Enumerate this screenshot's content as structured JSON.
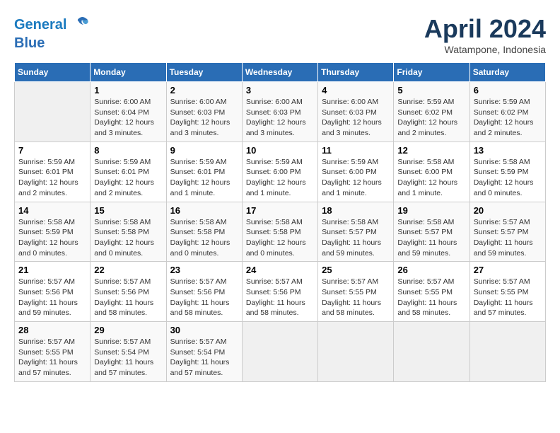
{
  "header": {
    "logo_line1": "General",
    "logo_line2": "Blue",
    "title": "April 2024",
    "subtitle": "Watampone, Indonesia"
  },
  "days_of_week": [
    "Sunday",
    "Monday",
    "Tuesday",
    "Wednesday",
    "Thursday",
    "Friday",
    "Saturday"
  ],
  "weeks": [
    [
      {
        "day": "",
        "sunrise": "",
        "sunset": "",
        "daylight": "",
        "empty": true
      },
      {
        "day": "1",
        "sunrise": "Sunrise: 6:00 AM",
        "sunset": "Sunset: 6:04 PM",
        "daylight": "Daylight: 12 hours and 3 minutes."
      },
      {
        "day": "2",
        "sunrise": "Sunrise: 6:00 AM",
        "sunset": "Sunset: 6:03 PM",
        "daylight": "Daylight: 12 hours and 3 minutes."
      },
      {
        "day": "3",
        "sunrise": "Sunrise: 6:00 AM",
        "sunset": "Sunset: 6:03 PM",
        "daylight": "Daylight: 12 hours and 3 minutes."
      },
      {
        "day": "4",
        "sunrise": "Sunrise: 6:00 AM",
        "sunset": "Sunset: 6:03 PM",
        "daylight": "Daylight: 12 hours and 3 minutes."
      },
      {
        "day": "5",
        "sunrise": "Sunrise: 5:59 AM",
        "sunset": "Sunset: 6:02 PM",
        "daylight": "Daylight: 12 hours and 2 minutes."
      },
      {
        "day": "6",
        "sunrise": "Sunrise: 5:59 AM",
        "sunset": "Sunset: 6:02 PM",
        "daylight": "Daylight: 12 hours and 2 minutes."
      }
    ],
    [
      {
        "day": "7",
        "sunrise": "Sunrise: 5:59 AM",
        "sunset": "Sunset: 6:01 PM",
        "daylight": "Daylight: 12 hours and 2 minutes."
      },
      {
        "day": "8",
        "sunrise": "Sunrise: 5:59 AM",
        "sunset": "Sunset: 6:01 PM",
        "daylight": "Daylight: 12 hours and 2 minutes."
      },
      {
        "day": "9",
        "sunrise": "Sunrise: 5:59 AM",
        "sunset": "Sunset: 6:01 PM",
        "daylight": "Daylight: 12 hours and 1 minute."
      },
      {
        "day": "10",
        "sunrise": "Sunrise: 5:59 AM",
        "sunset": "Sunset: 6:00 PM",
        "daylight": "Daylight: 12 hours and 1 minute."
      },
      {
        "day": "11",
        "sunrise": "Sunrise: 5:59 AM",
        "sunset": "Sunset: 6:00 PM",
        "daylight": "Daylight: 12 hours and 1 minute."
      },
      {
        "day": "12",
        "sunrise": "Sunrise: 5:58 AM",
        "sunset": "Sunset: 6:00 PM",
        "daylight": "Daylight: 12 hours and 1 minute."
      },
      {
        "day": "13",
        "sunrise": "Sunrise: 5:58 AM",
        "sunset": "Sunset: 5:59 PM",
        "daylight": "Daylight: 12 hours and 0 minutes."
      }
    ],
    [
      {
        "day": "14",
        "sunrise": "Sunrise: 5:58 AM",
        "sunset": "Sunset: 5:59 PM",
        "daylight": "Daylight: 12 hours and 0 minutes."
      },
      {
        "day": "15",
        "sunrise": "Sunrise: 5:58 AM",
        "sunset": "Sunset: 5:58 PM",
        "daylight": "Daylight: 12 hours and 0 minutes."
      },
      {
        "day": "16",
        "sunrise": "Sunrise: 5:58 AM",
        "sunset": "Sunset: 5:58 PM",
        "daylight": "Daylight: 12 hours and 0 minutes."
      },
      {
        "day": "17",
        "sunrise": "Sunrise: 5:58 AM",
        "sunset": "Sunset: 5:58 PM",
        "daylight": "Daylight: 12 hours and 0 minutes."
      },
      {
        "day": "18",
        "sunrise": "Sunrise: 5:58 AM",
        "sunset": "Sunset: 5:57 PM",
        "daylight": "Daylight: 11 hours and 59 minutes."
      },
      {
        "day": "19",
        "sunrise": "Sunrise: 5:58 AM",
        "sunset": "Sunset: 5:57 PM",
        "daylight": "Daylight: 11 hours and 59 minutes."
      },
      {
        "day": "20",
        "sunrise": "Sunrise: 5:57 AM",
        "sunset": "Sunset: 5:57 PM",
        "daylight": "Daylight: 11 hours and 59 minutes."
      }
    ],
    [
      {
        "day": "21",
        "sunrise": "Sunrise: 5:57 AM",
        "sunset": "Sunset: 5:56 PM",
        "daylight": "Daylight: 11 hours and 59 minutes."
      },
      {
        "day": "22",
        "sunrise": "Sunrise: 5:57 AM",
        "sunset": "Sunset: 5:56 PM",
        "daylight": "Daylight: 11 hours and 58 minutes."
      },
      {
        "day": "23",
        "sunrise": "Sunrise: 5:57 AM",
        "sunset": "Sunset: 5:56 PM",
        "daylight": "Daylight: 11 hours and 58 minutes."
      },
      {
        "day": "24",
        "sunrise": "Sunrise: 5:57 AM",
        "sunset": "Sunset: 5:56 PM",
        "daylight": "Daylight: 11 hours and 58 minutes."
      },
      {
        "day": "25",
        "sunrise": "Sunrise: 5:57 AM",
        "sunset": "Sunset: 5:55 PM",
        "daylight": "Daylight: 11 hours and 58 minutes."
      },
      {
        "day": "26",
        "sunrise": "Sunrise: 5:57 AM",
        "sunset": "Sunset: 5:55 PM",
        "daylight": "Daylight: 11 hours and 58 minutes."
      },
      {
        "day": "27",
        "sunrise": "Sunrise: 5:57 AM",
        "sunset": "Sunset: 5:55 PM",
        "daylight": "Daylight: 11 hours and 57 minutes."
      }
    ],
    [
      {
        "day": "28",
        "sunrise": "Sunrise: 5:57 AM",
        "sunset": "Sunset: 5:55 PM",
        "daylight": "Daylight: 11 hours and 57 minutes."
      },
      {
        "day": "29",
        "sunrise": "Sunrise: 5:57 AM",
        "sunset": "Sunset: 5:54 PM",
        "daylight": "Daylight: 11 hours and 57 minutes."
      },
      {
        "day": "30",
        "sunrise": "Sunrise: 5:57 AM",
        "sunset": "Sunset: 5:54 PM",
        "daylight": "Daylight: 11 hours and 57 minutes."
      },
      {
        "day": "",
        "sunrise": "",
        "sunset": "",
        "daylight": "",
        "empty": true
      },
      {
        "day": "",
        "sunrise": "",
        "sunset": "",
        "daylight": "",
        "empty": true
      },
      {
        "day": "",
        "sunrise": "",
        "sunset": "",
        "daylight": "",
        "empty": true
      },
      {
        "day": "",
        "sunrise": "",
        "sunset": "",
        "daylight": "",
        "empty": true
      }
    ]
  ]
}
